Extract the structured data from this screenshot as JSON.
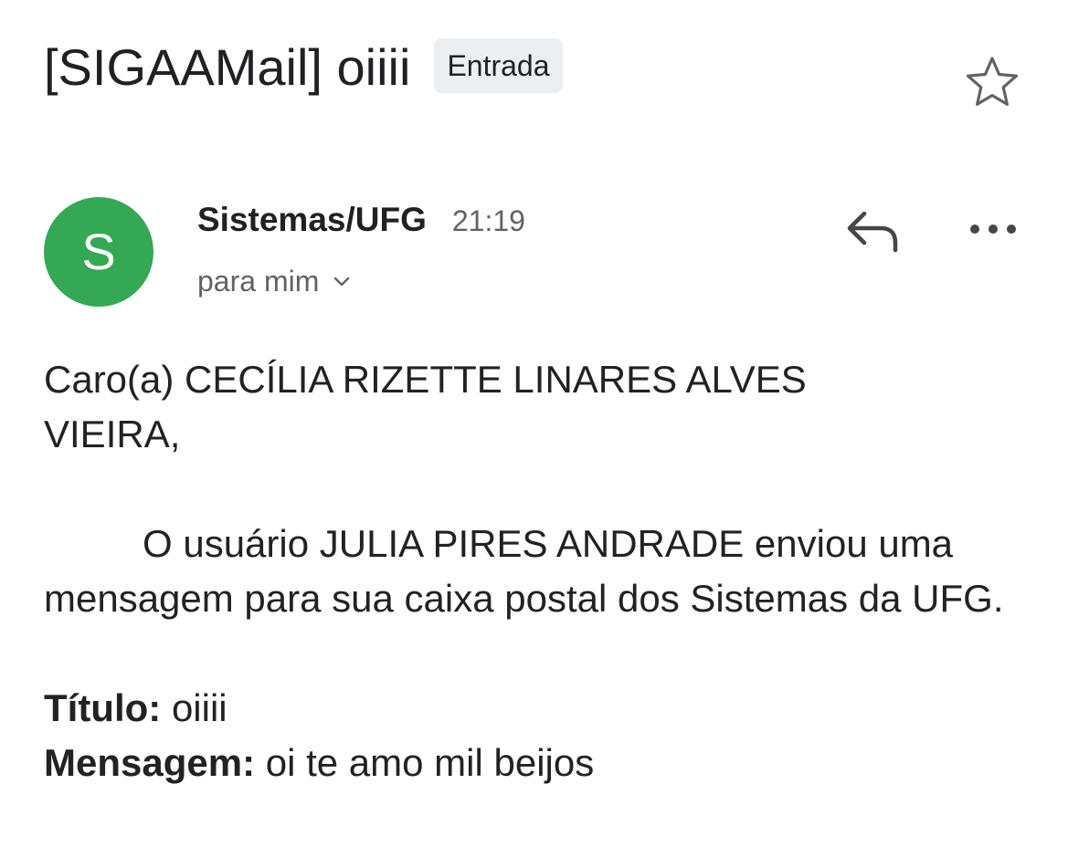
{
  "email": {
    "subject": "[SIGAAMail] oiiii",
    "label": "Entrada",
    "sender": {
      "avatar_letter": "S",
      "avatar_color": "#34a853",
      "name": "Sistemas/UFG",
      "time": "21:19",
      "recipient": "para mim"
    },
    "icons": {
      "star": "star-outline-icon",
      "reply": "reply-icon",
      "more": "more-horizontal-icon",
      "details": "chevron-down-icon"
    },
    "body": {
      "greeting": "Caro(a) CECÍLIA RIZETTE LINARES ALVES VIEIRA,",
      "paragraph": "O usuário JULIA PIRES ANDRADE enviou uma mensagem para sua caixa postal dos Sistemas da UFG.",
      "title_label": "Título:",
      "title_value": " oiiii",
      "message_label": "Mensagem:",
      "message_value": " oi te amo mil beijos"
    }
  }
}
